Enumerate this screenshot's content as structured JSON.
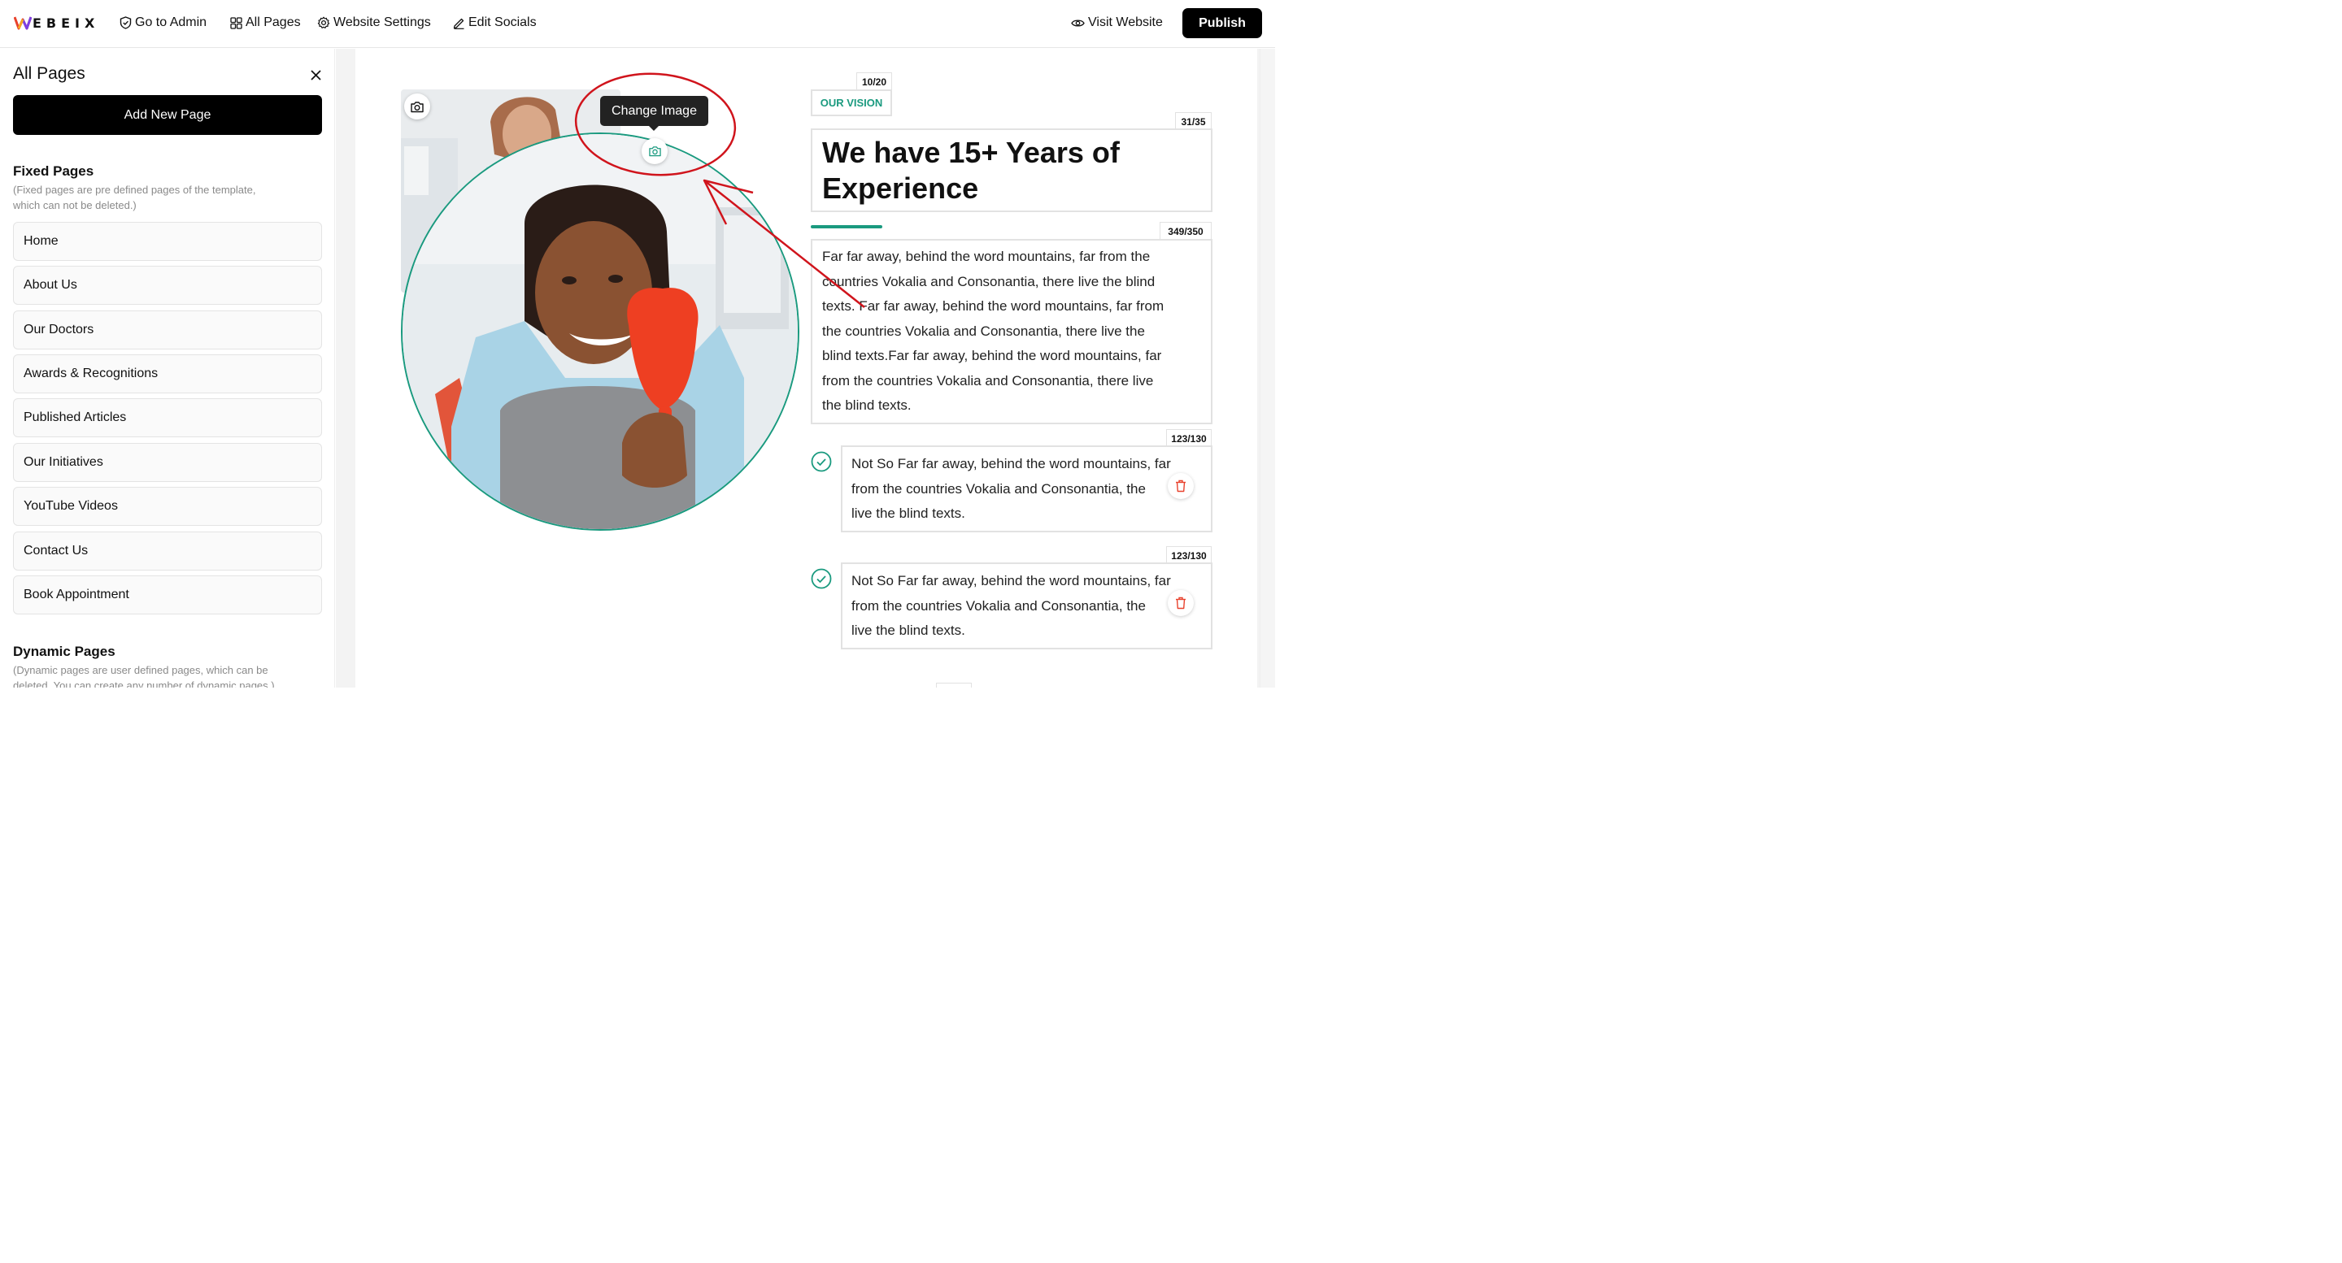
{
  "brand": {
    "logo_first": "W",
    "logo_rest": "EBEIX"
  },
  "topbar": {
    "go_to_admin": "Go to Admin",
    "all_pages": "All Pages",
    "website_settings": "Website Settings",
    "edit_socials": "Edit Socials",
    "visit_website": "Visit Website",
    "publish": "Publish"
  },
  "sidebar": {
    "title": "All Pages",
    "add_new_page": "Add New Page",
    "fixed": {
      "title": "Fixed Pages",
      "desc_line1": "(Fixed pages are pre defined pages of the template,",
      "desc_line2": "which can not be deleted.)",
      "items": [
        "Home",
        "About Us",
        "Our Doctors",
        "Awards & Recognitions",
        "Published Articles",
        "Our Initiatives",
        "YouTube Videos",
        "Contact Us",
        "Book Appointment"
      ]
    },
    "dynamic": {
      "title": "Dynamic Pages",
      "desc_line1": "(Dynamic pages are user defined pages, which can be",
      "desc_line2": "deleted. You can create any number of dynamic pages.)"
    }
  },
  "editor": {
    "tooltip": "Change Image",
    "eyebrow_counter": "10/20",
    "eyebrow": "OUR VISION",
    "headline_counter": "31/35",
    "headline_line1": "We have 15+ Years of",
    "headline_line2": "Experience",
    "para_counter": "349/350",
    "para_lines": [
      "Far far away, behind the word mountains, far from the",
      "countries Vokalia and Consonantia, there live the blind",
      "texts. Far far away, behind the word mountains, far from",
      "the countries Vokalia and Consonantia, there live the",
      "blind texts.Far far away, behind the word mountains, far",
      "from the countries Vokalia and Consonantia, there live",
      "the blind texts."
    ],
    "points": [
      {
        "counter": "123/130",
        "lines": [
          "Not So Far far away, behind the word mountains, far",
          "from the countries Vokalia and Consonantia, the",
          "live the blind texts."
        ]
      },
      {
        "counter": "123/130",
        "lines": [
          "Not So Far far away, behind the word mountains, far",
          "from the countries Vokalia and Consonantia, the",
          "live the blind texts."
        ]
      }
    ]
  },
  "colors": {
    "accent": "#1a9a7f",
    "annotation": "#d0141c",
    "primary_button": "#000000"
  }
}
